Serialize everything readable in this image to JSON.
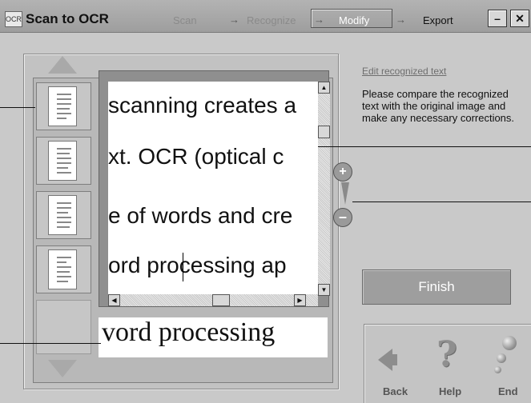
{
  "titlebar": {
    "app_icon_text": "OCR",
    "title": "Scan to OCR",
    "steps": [
      "Scan",
      "Recognize",
      "Modify",
      "Export"
    ],
    "current_step": "Modify",
    "minimize_label": "–",
    "close_label": "✕"
  },
  "text_view": {
    "lines": [
      "scanning creates a",
      "xt. OCR (optical c",
      "e of words and cre",
      "ord processing ap"
    ],
    "compare_text": "vord processing"
  },
  "zoom": {
    "in_label": "+",
    "out_label": "–"
  },
  "instructions": {
    "heading": "Edit recognized text",
    "body": "Please compare the recognized text with the original image and make any necessary corrections."
  },
  "finish_label": "Finish",
  "nav": {
    "back": "Back",
    "help": "Help",
    "end": "End"
  },
  "icons": {
    "app": "ocr-scanner-icon",
    "scroll_up": "arrow-up-icon",
    "scroll_down": "arrow-down-icon",
    "back": "back-arrow-icon",
    "help": "question-mark-icon",
    "end": "balls-icon"
  },
  "colors": {
    "background": "#c9c9c9",
    "finish_button": "#9e9e9e",
    "heading_link": "#6e6e6e"
  }
}
